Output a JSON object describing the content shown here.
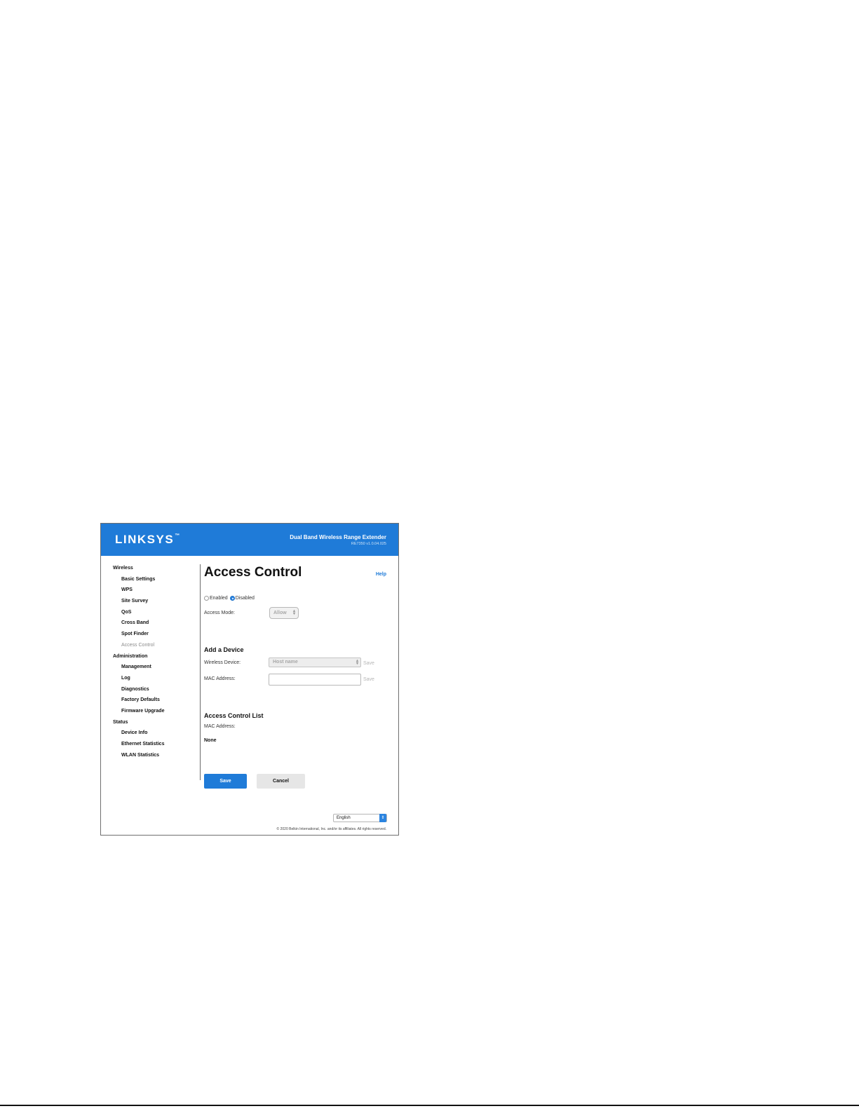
{
  "header": {
    "logo_text": "LINKSYS",
    "logo_mark": "™",
    "product_name": "Dual Band Wireless Range Extender",
    "firmware_version": "RE7350 v1.0.04.025"
  },
  "sidebar": {
    "sections": [
      {
        "label": "Wireless",
        "items": [
          "Basic Settings",
          "WPS",
          "Site Survey",
          "QoS",
          "Cross Band",
          "Spot Finder",
          "Access Control"
        ]
      },
      {
        "label": "Administration",
        "items": [
          "Management",
          "Log",
          "Diagnostics",
          "Factory Defaults",
          "Firmware Upgrade"
        ]
      },
      {
        "label": "Status",
        "items": [
          "Device Info",
          "Ethernet Statistics",
          "WLAN Statistics"
        ]
      }
    ],
    "active_item": "Access Control"
  },
  "main": {
    "title": "Access Control",
    "help_label": "Help",
    "toggle": {
      "enabled_label": "Enabled",
      "disabled_label": "Disabled",
      "selected": "Disabled"
    },
    "access_mode": {
      "label": "Access Mode:",
      "value": "Allow"
    },
    "add_device": {
      "heading": "Add a Device",
      "wireless_device_label": "Wireless Device:",
      "wireless_device_value": "Host name",
      "mac_label": "MAC Address:",
      "mac_value": "",
      "save_label": "Save"
    },
    "acl": {
      "heading": "Access Control List",
      "mac_label": "MAC Address:",
      "value": "None"
    },
    "save_button": "Save",
    "cancel_button": "Cancel"
  },
  "footer": {
    "language": "English",
    "copyright": "© 2020 Belkin International, Inc. and/or its affiliates. All rights reserved."
  },
  "colors": {
    "brand_blue": "#1f7bd8",
    "active_nav": "#8a8a8a",
    "disabled_text": "#a8a8a8"
  }
}
